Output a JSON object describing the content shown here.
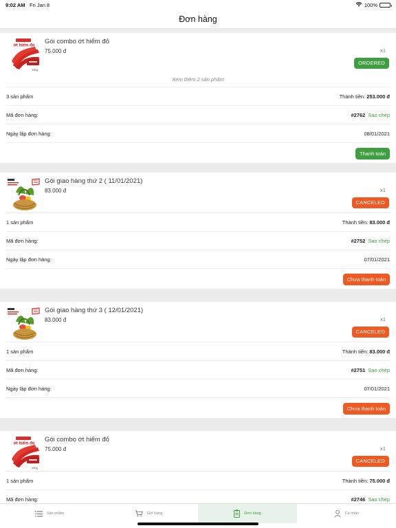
{
  "status_bar": {
    "time": "9:02 AM",
    "date": "Fri Jan 8",
    "battery": "100%"
  },
  "header": {
    "title": "Đơn hàng"
  },
  "orders": [
    {
      "product": {
        "name": "Gói combo ớt hiểm đỏ",
        "price": "75.000 đ",
        "qty": "x1",
        "image": "chili-product-image"
      },
      "status": "ORDERED",
      "status_color": "#3f9e3f",
      "see_more": "Xem thêm 2 sản phẩm",
      "count_label": "3 sản phẩm",
      "total_label": "Thành tiền:",
      "total_value": "253.000 đ",
      "code_label": "Mã đơn hàng:",
      "code_value": "#2762",
      "copy_label": "Sao chép",
      "date_label": "Ngày lập đơn hàng:",
      "date_value": "08/01/2021",
      "action_label": "Thanh toán",
      "action_color": "#3f9e3f"
    },
    {
      "product": {
        "name": "Gói giao hàng thứ 2 ( 11/01/2021)",
        "price": "83.000 đ",
        "qty": "x1",
        "image": "vegetable-basket-image"
      },
      "status": "CANCELED",
      "status_color": "#f05a22",
      "count_label": "1 sản phẩm",
      "total_label": "Thành tiền:",
      "total_value": "83.000 đ",
      "code_label": "Mã đơn hàng:",
      "code_value": "#2752",
      "copy_label": "Sao chép",
      "date_label": "Ngày lập đơn hàng:",
      "date_value": "07/01/2021",
      "action_label": "Chưa thanh toán",
      "action_color": "#f05a22"
    },
    {
      "product": {
        "name": "Gói giao hàng thứ 3 ( 12/01/2021)",
        "price": "83.000 đ",
        "qty": "x1",
        "image": "vegetable-basket-image"
      },
      "status": "CANCELED",
      "status_color": "#f05a22",
      "count_label": "1 sản phẩm",
      "total_label": "Thành tiền:",
      "total_value": "83.000 đ",
      "code_label": "Mã đơn hàng:",
      "code_value": "#2751",
      "copy_label": "Sao chép",
      "date_label": "Ngày lập đơn hàng:",
      "date_value": "07/01/2021",
      "action_label": "Chưa thanh toán",
      "action_color": "#f05a22"
    },
    {
      "product": {
        "name": "Gói combo ớt hiểm đỏ",
        "price": "75.000 đ",
        "qty": "x1",
        "image": "chili-product-image"
      },
      "status": "CANCELED",
      "status_color": "#f05a22",
      "count_label": "1 sản phẩm",
      "total_label": "Thành tiền:",
      "total_value": "75.000 đ",
      "code_label": "Mã đơn hàng:",
      "code_value": "#2746",
      "copy_label": "Sao chép"
    }
  ],
  "tabs": [
    {
      "label": "Sản phẩm",
      "icon": "list-icon",
      "active": false
    },
    {
      "label": "Giỏ hàng",
      "icon": "cart-icon",
      "active": false
    },
    {
      "label": "Đơn hàng",
      "icon": "clipboard-icon",
      "active": true
    },
    {
      "label": "Cá nhân",
      "icon": "user-icon",
      "active": false
    }
  ],
  "colors": {
    "accent_green": "#3f9e3f",
    "accent_orange": "#f05a22"
  }
}
